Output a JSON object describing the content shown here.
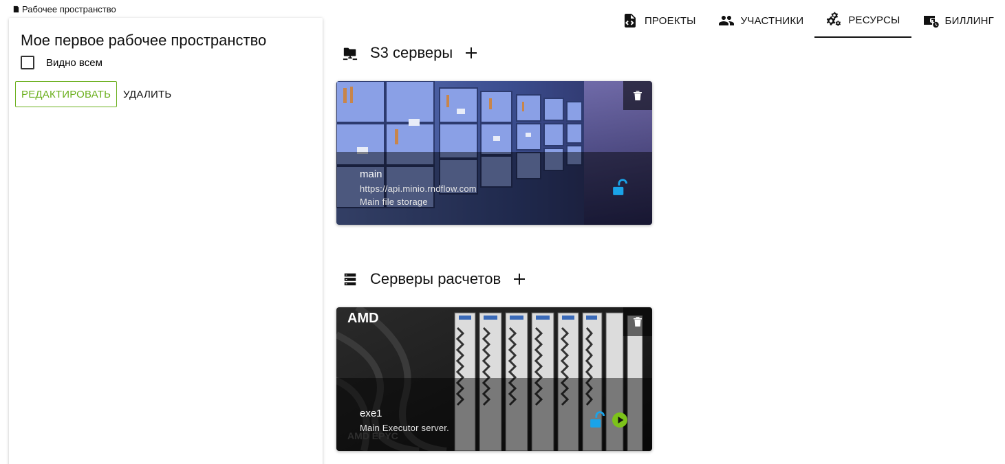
{
  "breadcrumb": {
    "label": "Рабочее пространство"
  },
  "workspace": {
    "title": "Мое первое рабочее пространство",
    "visibility_label": "Видно всем",
    "visibility_checked": false,
    "edit_label": "РЕДАКТИРОВАТЬ",
    "delete_label": "УДАЛИТЬ"
  },
  "tabs": [
    {
      "label": "ПРОЕКТЫ",
      "icon": "file-code-icon",
      "active": false
    },
    {
      "label": "УЧАСТНИКИ",
      "icon": "people-icon",
      "active": false
    },
    {
      "label": "РЕСУРСЫ",
      "icon": "gears-icon",
      "active": true
    },
    {
      "label": "БИЛЛИНГ",
      "icon": "wallet-clock-icon",
      "active": false
    }
  ],
  "s3": {
    "title": "S3 серверы",
    "cards": [
      {
        "name": "main",
        "url": "https://api.minio.rndflow.com",
        "description": "Main file storage"
      }
    ]
  },
  "compute": {
    "title": "Серверы расчетов",
    "cards": [
      {
        "name": "exe1",
        "description": "Main Executor server.",
        "brand_text": "AMD",
        "brand_text_bottom": "AMD EPYC"
      }
    ]
  },
  "colors": {
    "accent_green": "#6aaf1c",
    "lock_blue": "#1aa3e8",
    "play_green": "#7cc21a"
  }
}
